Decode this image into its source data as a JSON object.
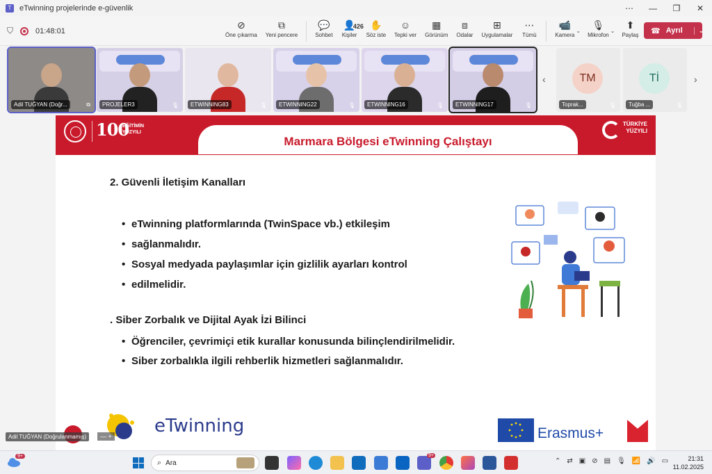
{
  "window": {
    "title": "eTwinning projelerinde e-güvenlik",
    "controls": [
      "⋯",
      "—",
      "❐",
      "✕"
    ]
  },
  "meeting": {
    "timer": "01:48:01",
    "toolbar": [
      {
        "label": "Öne çıkarma",
        "icon": "highlight-off-icon",
        "glyph": "⊘"
      },
      {
        "label": "Yeni pencere",
        "icon": "new-window-icon",
        "glyph": "⧉"
      },
      {
        "label": "Sohbet",
        "icon": "chat-icon",
        "glyph": "💬"
      },
      {
        "label": "Kişiler",
        "icon": "people-icon",
        "glyph": "👤",
        "count": "426"
      },
      {
        "label": "Söz iste",
        "icon": "raise-hand-icon",
        "glyph": "✋"
      },
      {
        "label": "Tepki ver",
        "icon": "reaction-icon",
        "glyph": "☺"
      },
      {
        "label": "Görünüm",
        "icon": "view-icon",
        "glyph": "▦"
      },
      {
        "label": "Odalar",
        "icon": "rooms-icon",
        "glyph": "⧈"
      },
      {
        "label": "Uygulamalar",
        "icon": "apps-icon",
        "glyph": "⊞"
      },
      {
        "label": "Tümü",
        "icon": "more-icon",
        "glyph": "⋯"
      }
    ],
    "media": [
      {
        "label": "Kamera",
        "icon": "camera-icon",
        "glyph": "📹"
      },
      {
        "label": "Mikrofon",
        "icon": "mic-off-icon",
        "glyph": "🎙"
      },
      {
        "label": "Paylaş",
        "icon": "share-icon",
        "glyph": "⬆"
      }
    ],
    "leave_label": "Ayrıl",
    "accent": "#5b5fc7",
    "leave_color": "#c4314b"
  },
  "participants": [
    {
      "name": "Adil TUĞYAN (Doğr...",
      "type": "video",
      "skin": "#c9a58a",
      "shirt": "#3a3a3a",
      "bg": "#8e8a87"
    },
    {
      "name": "PROJELER3",
      "type": "video",
      "skin": "#c49a7c",
      "shirt": "#222222",
      "bg": "#d6d0e6"
    },
    {
      "name": "ETWINNING83",
      "type": "video",
      "skin": "#e0b8a0",
      "shirt": "#c62828",
      "bg": "#e9e6ef"
    },
    {
      "name": "ETWINNING22",
      "type": "video",
      "skin": "#e6c3a8",
      "shirt": "#6d6d6d",
      "bg": "#d8d1ea"
    },
    {
      "name": "ETWINNING16",
      "type": "video",
      "skin": "#d9b094",
      "shirt": "#2b2b2b",
      "bg": "#dcd5ec"
    },
    {
      "name": "ETWINNING17",
      "type": "video",
      "skin": "#b98a6e",
      "shirt": "#1e1e1e",
      "bg": "#d4cde6"
    },
    {
      "name": "Toprak...",
      "type": "avatar",
      "initials": "TM",
      "avatar_bg": "#f5d2c8",
      "avatar_fg": "#7a2e1e"
    },
    {
      "name": "Tuğba ...",
      "type": "avatar",
      "initials": "Tİ",
      "avatar_bg": "#d4ede7",
      "avatar_fg": "#1e6b5a"
    }
  ],
  "slide": {
    "header_title": "Marmara Bölgesi eTwinning Çalıştayı",
    "logo_100": "100",
    "logo_100_text": "EĞİTİMİN\nYÜZYILI",
    "logo_turkiye": "TÜRKİYE\nYÜZYILI",
    "section1_title": "2. Güvenli İletişim Kanalları",
    "section1_bullets": [
      "eTwinning platformlarında (TwinSpace vb.) etkileşim",
      "sağlanmalıdır.",
      "Sosyal medyada paylaşımlar için gizlilik ayarları kontrol",
      "edilmelidir."
    ],
    "section2_title": ". Siber Zorbalık ve Dijital Ayak İzi Bilinci",
    "section2_bullets": [
      "Öğrenciler, çevrimiçi etik kurallar konusunda bilinçlendirilmelidir.",
      "Siber zorbalıkla ilgili rehberlik hizmetleri sağlanmalıdır."
    ],
    "footer_etwinning": "eTwinning",
    "footer_erasmus": "Erasmus+",
    "header_color": "#c91a2c"
  },
  "presenter_tag": "Adil TUĞYAN (Doğrulanmamış)",
  "taskbar": {
    "search_placeholder": "Ara",
    "weather_badge": "9+",
    "teams_badge": "9+",
    "time": "21:31",
    "date": "11.02.2025"
  }
}
